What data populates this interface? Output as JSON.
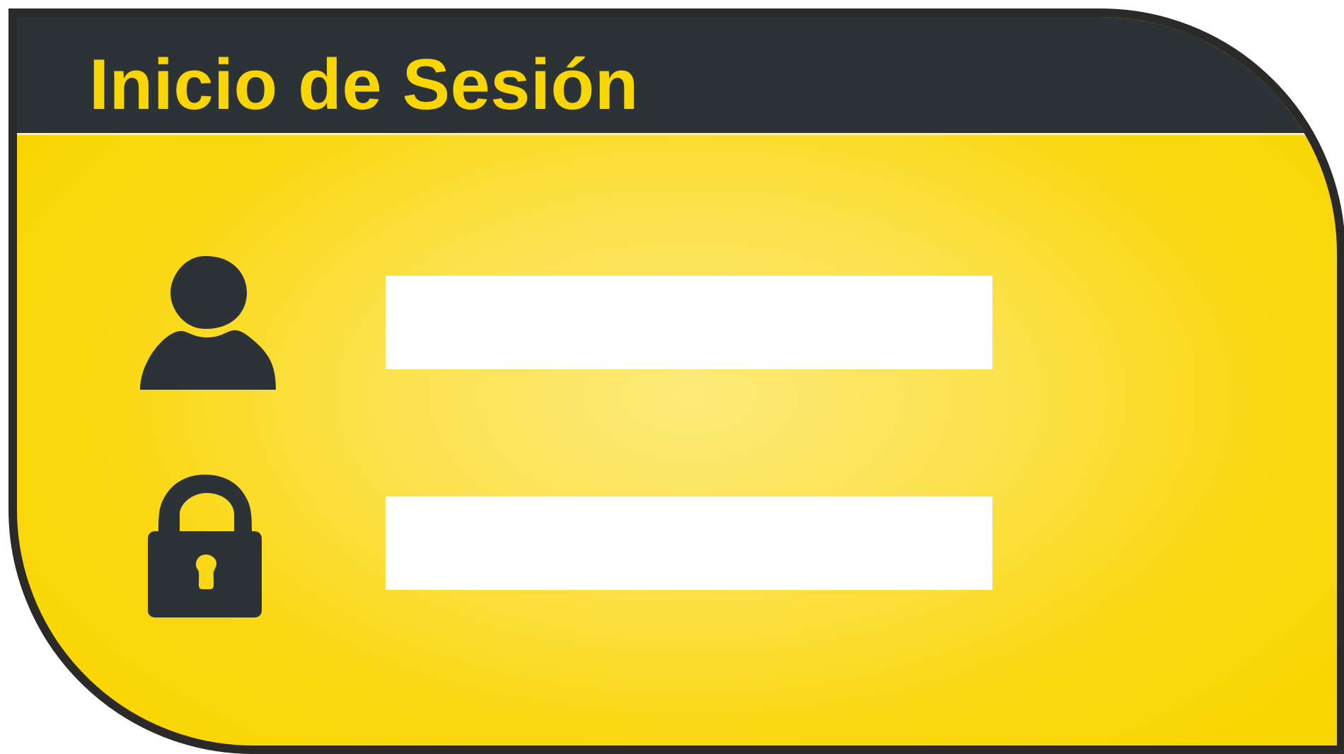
{
  "header": {
    "title": "Inicio de Sesión"
  },
  "icons": {
    "user": "user-icon",
    "lock": "lock-icon"
  },
  "form": {
    "username": {
      "value": "",
      "placeholder": ""
    },
    "password": {
      "value": "",
      "placeholder": ""
    }
  },
  "colors": {
    "header_background": "#2c3337",
    "title": "#f9d600",
    "body_edge": "#f9d600",
    "body_center": "#fdea79",
    "border": "#2b2a28",
    "icons": "#2c3337",
    "fields": "#ffffff"
  }
}
